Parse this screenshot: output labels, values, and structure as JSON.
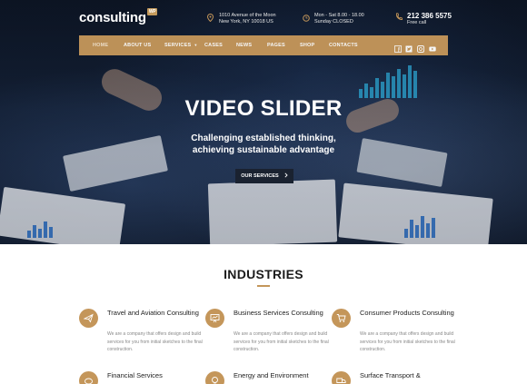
{
  "header": {
    "logo_text": "consulting",
    "logo_badge": "WP",
    "address": {
      "line1": "1010 Avenue of the Moon",
      "line2": "New York, NY 10018 US"
    },
    "hours": {
      "line1": "Mon - Sat 8.00 - 18.00",
      "line2": "Sunday CLOSED"
    },
    "phone": {
      "number": "212 386 5575",
      "label": "Free call"
    }
  },
  "nav": {
    "items": [
      {
        "label": "HOME",
        "active": true
      },
      {
        "label": "ABOUT US"
      },
      {
        "label": "SERVICES",
        "has_dropdown": true
      },
      {
        "label": "CASES"
      },
      {
        "label": "NEWS"
      },
      {
        "label": "PAGES"
      },
      {
        "label": "SHOP"
      },
      {
        "label": "CONTACTS"
      }
    ],
    "social": [
      "facebook-icon",
      "twitter-icon",
      "instagram-icon",
      "youtube-icon"
    ]
  },
  "hero": {
    "title": "VIDEO SLIDER",
    "subtitle": "Challenging established thinking, achieving sustainable advantage",
    "button_label": "OUR SERVICES"
  },
  "industries": {
    "title": "INDUSTRIES",
    "desc": "We are a company that offers design and build services for you from initial sketches to the final construction.",
    "cards": [
      {
        "title": "Travel and Aviation Consulting",
        "icon": "plane-icon"
      },
      {
        "title": "Business Services Consulting",
        "icon": "presentation-icon"
      },
      {
        "title": "Consumer Products Consulting",
        "icon": "cart-icon"
      },
      {
        "title": "Financial Services",
        "icon": "piggy-bank-icon"
      },
      {
        "title": "Energy and Environment",
        "icon": "bulb-icon"
      },
      {
        "title": "Surface Transport &",
        "icon": "truck-icon"
      }
    ]
  },
  "colors": {
    "accent": "#c4965a",
    "dark": "#1a2230",
    "hero_bg": "#15233a"
  }
}
